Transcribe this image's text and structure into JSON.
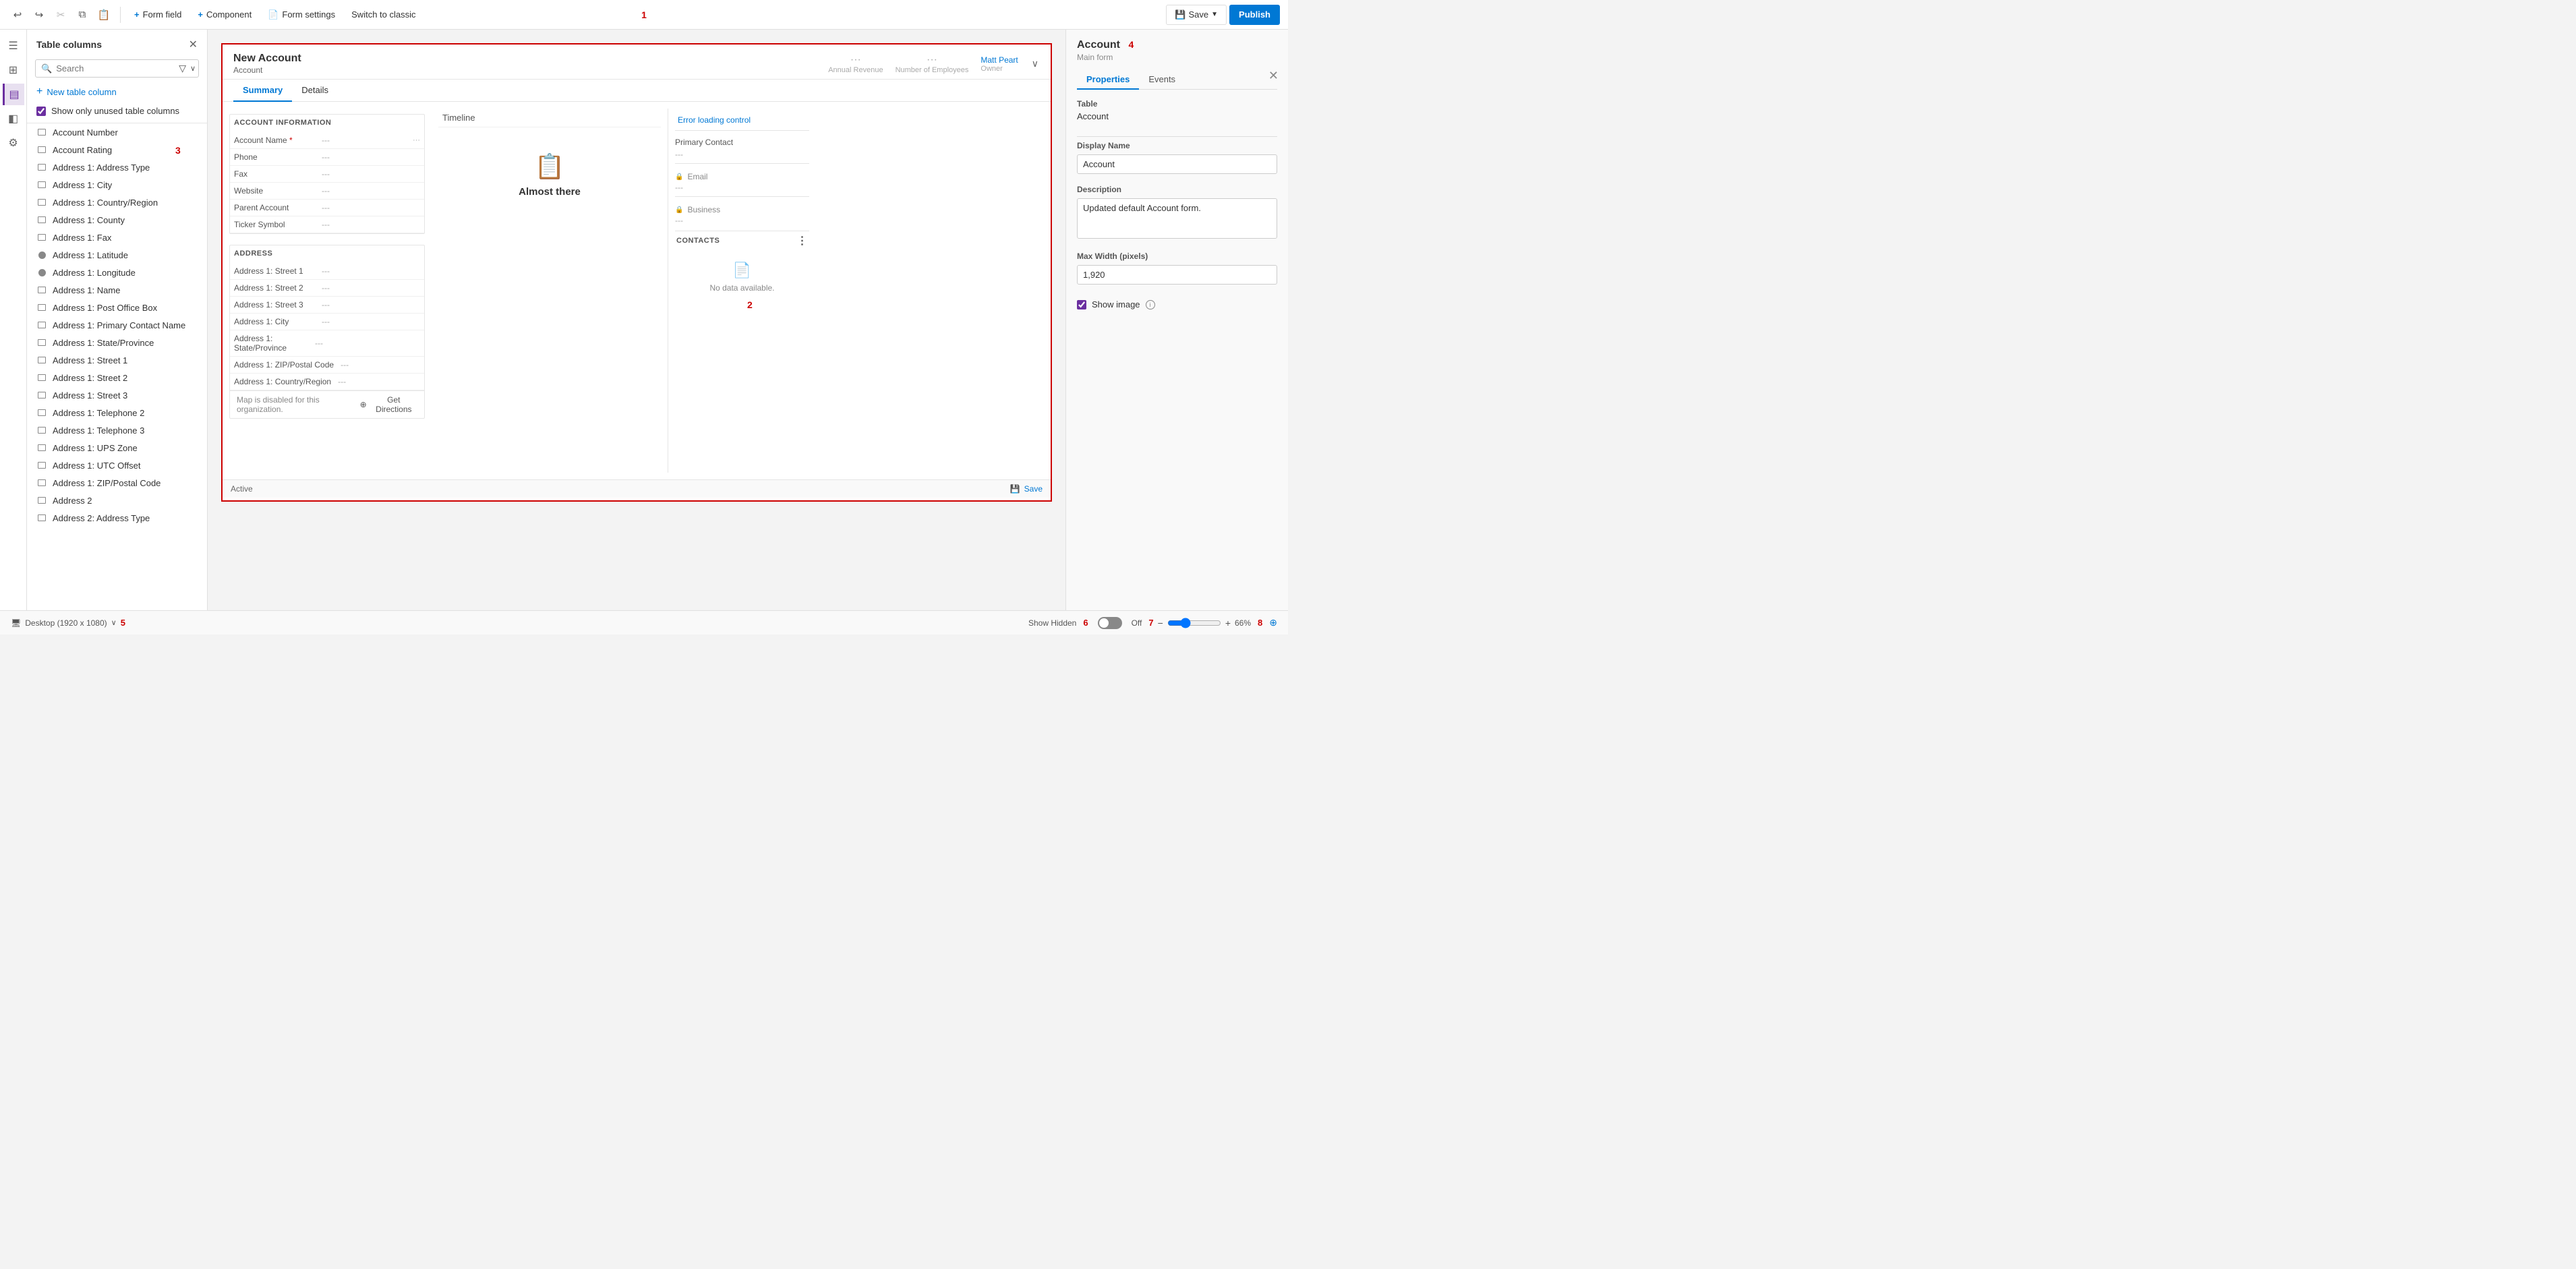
{
  "toolbar": {
    "undo_label": "↩",
    "redo_label": "↪",
    "cut_label": "✂",
    "copy_label": "⧉",
    "paste_label": "📋",
    "form_field_label": "Form field",
    "component_label": "Component",
    "form_settings_label": "Form settings",
    "switch_to_classic_label": "Switch to classic",
    "save_label": "Save",
    "publish_label": "Publish",
    "number_label": "1"
  },
  "sidebar": {
    "title": "Table columns",
    "search_placeholder": "Search",
    "new_column_label": "New table column",
    "show_unused_label": "Show only unused table columns",
    "number_label": "3",
    "items": [
      {
        "label": "Account Number",
        "icon": "rect"
      },
      {
        "label": "Account Rating",
        "icon": "rect"
      },
      {
        "label": "Address 1: Address Type",
        "icon": "rect"
      },
      {
        "label": "Address 1: City",
        "icon": "rect"
      },
      {
        "label": "Address 1: Country/Region",
        "icon": "rect"
      },
      {
        "label": "Address 1: County",
        "icon": "rect"
      },
      {
        "label": "Address 1: Fax",
        "icon": "rect"
      },
      {
        "label": "Address 1: Latitude",
        "icon": "circle"
      },
      {
        "label": "Address 1: Longitude",
        "icon": "circle"
      },
      {
        "label": "Address 1: Name",
        "icon": "rect"
      },
      {
        "label": "Address 1: Post Office Box",
        "icon": "rect"
      },
      {
        "label": "Address 1: Primary Contact Name",
        "icon": "rect"
      },
      {
        "label": "Address 1: State/Province",
        "icon": "rect"
      },
      {
        "label": "Address 1: Street 1",
        "icon": "rect"
      },
      {
        "label": "Address 1: Street 2",
        "icon": "rect"
      },
      {
        "label": "Address 1: Street 3",
        "icon": "rect"
      },
      {
        "label": "Address 1: Telephone 2",
        "icon": "rect"
      },
      {
        "label": "Address 1: Telephone 3",
        "icon": "rect"
      },
      {
        "label": "Address 1: UPS Zone",
        "icon": "rect"
      },
      {
        "label": "Address 1: UTC Offset",
        "icon": "rect"
      },
      {
        "label": "Address 1: ZIP/Postal Code",
        "icon": "rect"
      },
      {
        "label": "Address 2",
        "icon": "rect"
      },
      {
        "label": "Address 2: Address Type",
        "icon": "rect"
      }
    ]
  },
  "form_canvas": {
    "number_label": "2",
    "title": "New Account",
    "subtitle": "Account",
    "header_cols": [
      "Annual Revenue",
      "Number of Employees"
    ],
    "owner_name": "Matt Peart",
    "tabs": [
      "Summary",
      "Details"
    ],
    "active_tab": "Summary",
    "account_info_section": {
      "title": "ACCOUNT INFORMATION",
      "fields": [
        {
          "label": "Account Name",
          "value": "---",
          "required": true
        },
        {
          "label": "Phone",
          "value": "---"
        },
        {
          "label": "Fax",
          "value": "---"
        },
        {
          "label": "Website",
          "value": "---"
        },
        {
          "label": "Parent Account",
          "value": "---"
        },
        {
          "label": "Ticker Symbol",
          "value": "---"
        }
      ]
    },
    "timeline": {
      "header": "Timeline",
      "icon": "📋",
      "label": "Almost there"
    },
    "right_sub_panel": {
      "error_loading": "Error loading control",
      "primary_contact_label": "Primary Contact",
      "primary_contact_value": "---",
      "email_label": "Email",
      "email_value": "---",
      "business_label": "Business",
      "business_value": "---",
      "contacts_header": "CONTACTS",
      "no_data": "No data available."
    },
    "address_section": {
      "title": "ADDRESS",
      "fields": [
        {
          "label": "Address 1: Street 1",
          "value": "---"
        },
        {
          "label": "Address 1: Street 2",
          "value": "---"
        },
        {
          "label": "Address 1: Street 3",
          "value": "---"
        },
        {
          "label": "Address 1: City",
          "value": "---"
        },
        {
          "label": "Address 1: State/Province",
          "value": "---"
        },
        {
          "label": "Address 1: ZIP/Postal Code",
          "value": "---"
        },
        {
          "label": "Address 1: Country/Region",
          "value": "---"
        }
      ]
    },
    "map_row": {
      "get_directions_label": "Get Directions",
      "disabled_text": "Map is disabled for this organization."
    },
    "footer": {
      "status": "Active",
      "save_label": "Save"
    }
  },
  "right_panel": {
    "number_label": "4",
    "title": "Account",
    "subtitle": "Main form",
    "tabs": [
      "Properties",
      "Events"
    ],
    "active_tab": "Properties",
    "table_label": "Table",
    "table_value": "Account",
    "display_name_label": "Display Name",
    "display_name_value": "Account",
    "description_label": "Description",
    "description_value": "Updated default Account form.",
    "max_width_label": "Max Width (pixels)",
    "max_width_value": "1,920",
    "show_image_label": "Show image"
  },
  "bottom_bar": {
    "number_label_5": "5",
    "number_label_6": "6",
    "number_label_7": "7",
    "number_label_8": "8",
    "desktop_label": "Desktop (1920 x 1080)",
    "show_hidden_label": "Show Hidden",
    "off_label": "Off",
    "zoom_percent": "66%",
    "zoom_icon": "⊕"
  },
  "icon_nav": {
    "items": [
      {
        "icon": "☰",
        "name": "menu"
      },
      {
        "icon": "⊞",
        "name": "components"
      },
      {
        "icon": "▤",
        "name": "fields"
      },
      {
        "icon": "◧",
        "name": "layers"
      },
      {
        "icon": "⚙",
        "name": "settings"
      }
    ]
  }
}
